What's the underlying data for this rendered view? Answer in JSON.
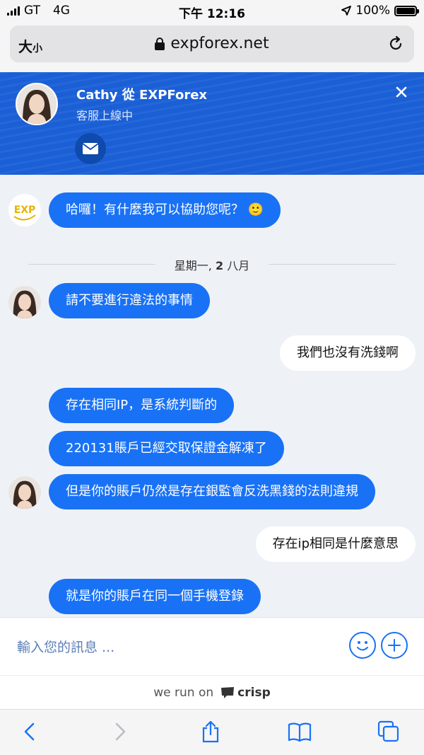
{
  "status_bar": {
    "carrier": "GT",
    "network": "4G",
    "time": "下午 12:16",
    "battery": "100%",
    "battery_level": 1.0
  },
  "browser": {
    "text_size_big": "大",
    "text_size_small": "小",
    "domain": "expforex.net"
  },
  "chat_header": {
    "agent_title": "Cathy 從 EXPForex",
    "agent_status": "客服上線中"
  },
  "messages": [
    {
      "from": "operator",
      "text": "哈囉！有什麼我可以協助您呢？ 🙂"
    },
    {
      "from": "operator",
      "text": "請不要進行違法的事情"
    },
    {
      "from": "user",
      "text": "我們也沒有洗錢啊"
    },
    {
      "from": "operator",
      "text": "存在相同IP，是系統判斷的"
    },
    {
      "from": "operator",
      "text": "220131賬戶已經交取保證金解凍了"
    },
    {
      "from": "operator",
      "text": "但是你的賬戶仍然是存在銀監會反洗黑錢的法則違規"
    },
    {
      "from": "user",
      "text": "存在ip相同是什麼意思"
    },
    {
      "from": "operator",
      "text": "就是你的賬戶在同一個手機登錄"
    }
  ],
  "day_divider": {
    "prefix": "星期一, ",
    "day": "2",
    "suffix": " 八月"
  },
  "composer": {
    "placeholder": "輸入您的訊息 ..."
  },
  "powered_by": {
    "text": "we run on",
    "brand": "crisp"
  },
  "logo": {
    "text": "EXP"
  },
  "colors": {
    "accent": "#1972f5",
    "header": "#1a5fd6"
  }
}
